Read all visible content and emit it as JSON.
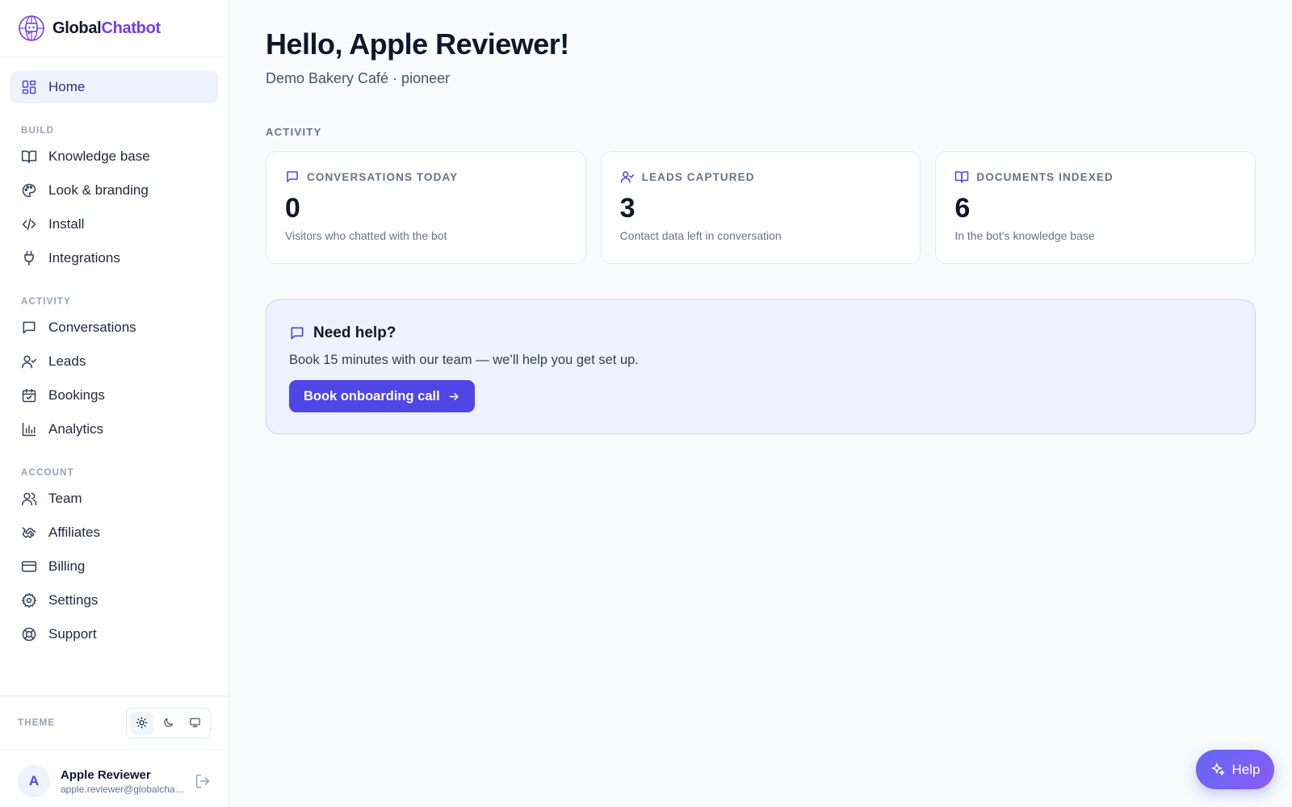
{
  "brand": {
    "name_part1": "Global",
    "name_part2": "Chatbot",
    "logo_icon": "globe-chat-icon"
  },
  "colors": {
    "accent": "#4f46e5",
    "brand": "#7c3aed",
    "sidebar_active_bg": "#eef2ff",
    "help_bg": "#eef2ff"
  },
  "sidebar": {
    "home": {
      "label": "Home",
      "icon": "grid-icon"
    },
    "sections": {
      "build": "BUILD",
      "activity": "ACTIVITY",
      "account": "ACCOUNT"
    },
    "build_items": [
      {
        "label": "Knowledge base",
        "icon": "book-icon"
      },
      {
        "label": "Look & branding",
        "icon": "palette-icon"
      },
      {
        "label": "Install",
        "icon": "code-icon"
      },
      {
        "label": "Integrations",
        "icon": "plug-icon"
      }
    ],
    "activity_items": [
      {
        "label": "Conversations",
        "icon": "message-icon"
      },
      {
        "label": "Leads",
        "icon": "user-check-icon"
      },
      {
        "label": "Bookings",
        "icon": "calendar-check-icon"
      },
      {
        "label": "Analytics",
        "icon": "bar-chart-icon"
      }
    ],
    "account_items": [
      {
        "label": "Team",
        "icon": "users-icon"
      },
      {
        "label": "Affiliates",
        "icon": "handshake-icon"
      },
      {
        "label": "Billing",
        "icon": "credit-card-icon"
      },
      {
        "label": "Settings",
        "icon": "gear-icon"
      },
      {
        "label": "Support",
        "icon": "life-buoy-icon"
      }
    ],
    "theme_label": "THEME",
    "theme_options": [
      "light",
      "dark",
      "system"
    ],
    "theme_selected": "light",
    "user": {
      "initial": "A",
      "name": "Apple Reviewer",
      "email": "apple.reviewer@globalchatbot.com"
    }
  },
  "main": {
    "title": "Hello, Apple Reviewer!",
    "subtitle": "Demo Bakery Café · pioneer",
    "activity_label": "ACTIVITY",
    "cards": [
      {
        "label": "CONVERSATIONS TODAY",
        "value": "0",
        "desc": "Visitors who chatted with the bot",
        "icon": "message-icon"
      },
      {
        "label": "LEADS CAPTURED",
        "value": "3",
        "desc": "Contact data left in conversation",
        "icon": "user-check-icon"
      },
      {
        "label": "DOCUMENTS INDEXED",
        "value": "6",
        "desc": "In the bot’s knowledge base",
        "icon": "book-icon"
      }
    ],
    "help": {
      "title": "Need help?",
      "text": "Book 15 minutes with our team — we’ll help you get set up.",
      "cta": "Book onboarding call"
    }
  },
  "fab": {
    "label": "Help",
    "icon": "sparkles-icon"
  }
}
